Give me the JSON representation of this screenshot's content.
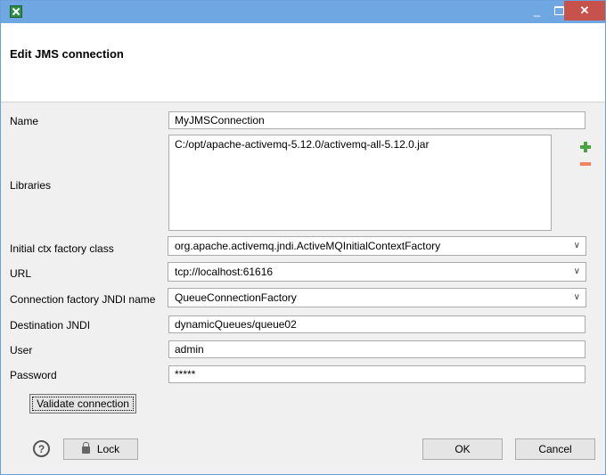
{
  "window": {
    "title": "",
    "controls": {
      "minimize": "_",
      "maximize": "□",
      "close": "✕"
    }
  },
  "header": {
    "title": "Edit JMS connection"
  },
  "form": {
    "name": {
      "label": "Name",
      "value": "MyJMSConnection"
    },
    "libraries": {
      "label": "Libraries",
      "items": [
        "C:/opt/apache-activemq-5.12.0/activemq-all-5.12.0.jar"
      ]
    },
    "initial_ctx_factory": {
      "label": "Initial ctx factory class",
      "value": "org.apache.activemq.jndi.ActiveMQInitialContextFactory"
    },
    "url": {
      "label": "URL",
      "value": "tcp://localhost:61616"
    },
    "connection_factory": {
      "label": "Connection factory JNDI name",
      "value": "QueueConnectionFactory"
    },
    "destination": {
      "label": "Destination JNDI",
      "value": "dynamicQueues/queue02"
    },
    "user": {
      "label": "User",
      "value": "admin"
    },
    "password": {
      "label": "Password",
      "value": "*****"
    }
  },
  "buttons": {
    "validate": "Validate connection",
    "lock": "Lock",
    "ok": "OK",
    "cancel": "Cancel",
    "help": "?"
  },
  "icons": [
    "app-icon",
    "add-icon",
    "remove-icon",
    "help-icon",
    "lock-icon",
    "chevron-down-icon"
  ]
}
